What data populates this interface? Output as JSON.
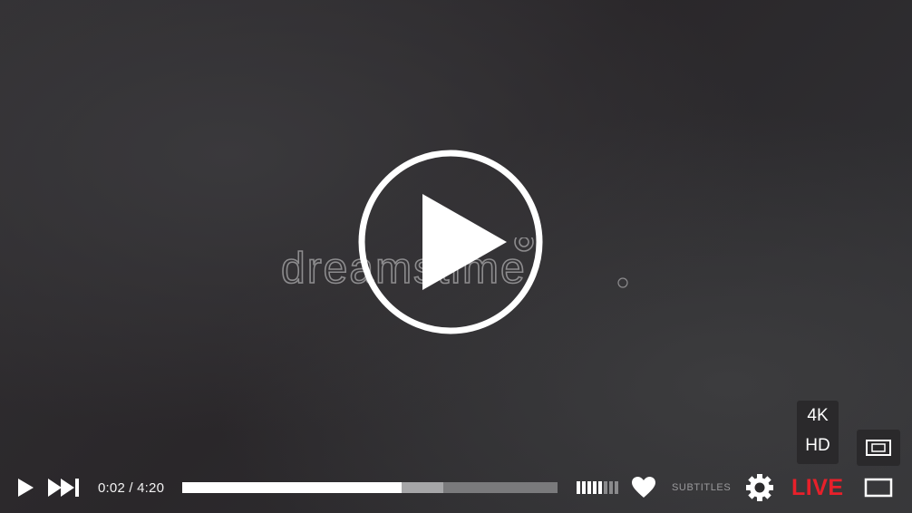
{
  "player": {
    "time": {
      "current": "0:02",
      "separator": "/",
      "duration": "4:20"
    },
    "progress": {
      "played_fraction": 0.585,
      "buffered_fraction": 0.695
    },
    "volume": {
      "bars_total": 8,
      "bars_active": 5
    },
    "subtitles_label": "SUBTITLES",
    "live_label": "LIVE",
    "quality_options": [
      "4K",
      "HD"
    ],
    "watermark": "dreamstime",
    "colors": {
      "live": "#e8202a",
      "icons": "#ffffff",
      "progress_played": "#ffffff",
      "progress_buffered": "#a6a6a8",
      "progress_track": "#7a7a7c"
    },
    "icons": {
      "play_overlay": "play-circle-icon",
      "play": "play-icon",
      "skip": "skip-next-icon",
      "like": "heart-icon",
      "settings": "gear-icon",
      "pip": "picture-in-picture-icon",
      "fullscreen": "fullscreen-icon"
    }
  }
}
